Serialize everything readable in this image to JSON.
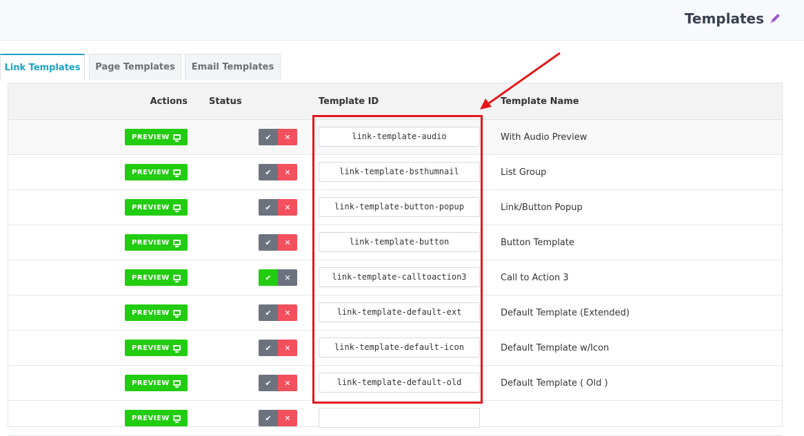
{
  "header": {
    "title": "Templates",
    "edit_icon": "pencil-icon",
    "edit_color": "#9b59d6"
  },
  "tabs": [
    {
      "label": "Link Templates",
      "active": true
    },
    {
      "label": "Page Templates",
      "active": false
    },
    {
      "label": "Email Templates",
      "active": false
    }
  ],
  "table": {
    "columns": {
      "actions": "Actions",
      "status": "Status",
      "template_id": "Template ID",
      "template_name": "Template Name"
    },
    "preview_label": "PREVIEW",
    "rows": [
      {
        "template_id": "link-template-audio",
        "template_name": "With Audio Preview",
        "enabled": false
      },
      {
        "template_id": "link-template-bsthumnail",
        "template_name": "List Group",
        "enabled": false
      },
      {
        "template_id": "link-template-button-popup",
        "template_name": "Link/Button Popup",
        "enabled": false
      },
      {
        "template_id": "link-template-button",
        "template_name": "Button Template",
        "enabled": false
      },
      {
        "template_id": "link-template-calltoaction3",
        "template_name": "Call to Action 3",
        "enabled": true
      },
      {
        "template_id": "link-template-default-ext",
        "template_name": "Default Template (Extended)",
        "enabled": false
      },
      {
        "template_id": "link-template-default-icon",
        "template_name": "Default Template w/Icon",
        "enabled": false
      },
      {
        "template_id": "link-template-default-old",
        "template_name": "Default Template ( Old )",
        "enabled": false
      },
      {
        "template_id": "",
        "template_name": "",
        "enabled": false
      }
    ]
  },
  "colors": {
    "accent": "#1aa3c8",
    "preview_green": "#22cc11",
    "disable_red": "#f2505d",
    "annotation_red": "#e5161a"
  }
}
